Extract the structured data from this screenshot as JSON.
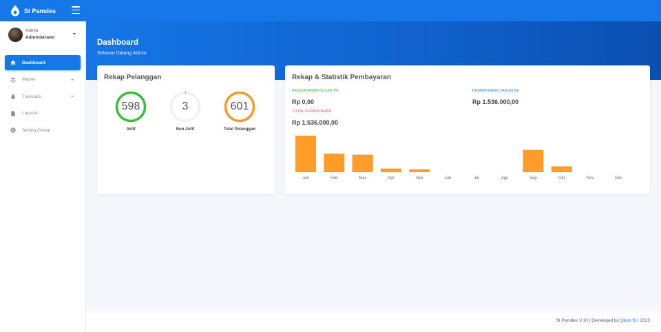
{
  "app": {
    "brand": "St Pamdes",
    "icons": {
      "logo": "water-drop-logo-icon",
      "menu": "hamburger-icon"
    }
  },
  "user": {
    "name": "Admin",
    "role": "Administrator"
  },
  "sidebar": {
    "items": [
      {
        "label": "Dashboard",
        "icon": "home-icon",
        "active": true,
        "has_caret": false
      },
      {
        "label": "Master",
        "icon": "database-icon",
        "active": false,
        "has_caret": true
      },
      {
        "label": "Transaksi",
        "icon": "drop-icon",
        "active": false,
        "has_caret": true
      },
      {
        "label": "Laporan",
        "icon": "file-icon",
        "active": false,
        "has_caret": false
      },
      {
        "label": "Setting Global",
        "icon": "gear-icon",
        "active": false,
        "has_caret": false
      }
    ]
  },
  "header": {
    "title": "Dashboard",
    "subtitle": "Selamat Datang Admin"
  },
  "rekap_pelanggan": {
    "title": "Rekap Pelanggan",
    "gauges": [
      {
        "value": "598",
        "label": "Aktif",
        "color": "#3dbb3d",
        "fraction": 1.0
      },
      {
        "value": "3",
        "label": "Non Aktif",
        "color": "#e0566a",
        "fraction": 0.005
      },
      {
        "value": "601",
        "label": "Total Pelanggan",
        "color": "#f59a2e",
        "fraction": 1.0
      }
    ]
  },
  "rekap_pembayaran": {
    "title": "Rekap & Statistik Pembayaran",
    "bulan_ini": {
      "label": "PEMBAYARAN BULAN INI",
      "value": "Rp 0,00",
      "color": "#3dbb3d"
    },
    "tahun_ini": {
      "label": "PEMBAYARAN TAHUN INI",
      "value": "Rp 1.536.000,00",
      "color": "#2e86de"
    },
    "total": {
      "label": "TOTAL PEMBAYARAN",
      "value": "Rp 1.536.000,00",
      "color": "#e0566a"
    }
  },
  "chart_data": {
    "type": "bar",
    "categories": [
      "Jan",
      "Feb",
      "Mar",
      "Apr",
      "Mei",
      "Jun",
      "Jul",
      "Ags",
      "Sep",
      "Okt",
      "Nov",
      "Des"
    ],
    "values": [
      100,
      51,
      48,
      10,
      8,
      0,
      0,
      0,
      61,
      16,
      0,
      0
    ],
    "ylim": [
      0,
      100
    ],
    "color": "#ff9c2a",
    "grid": false,
    "legend": false
  },
  "footer": {
    "prefix": "St Pamdes V.10 | Developed by",
    "link": "Qkoh St",
    "suffix": "| 2023"
  }
}
